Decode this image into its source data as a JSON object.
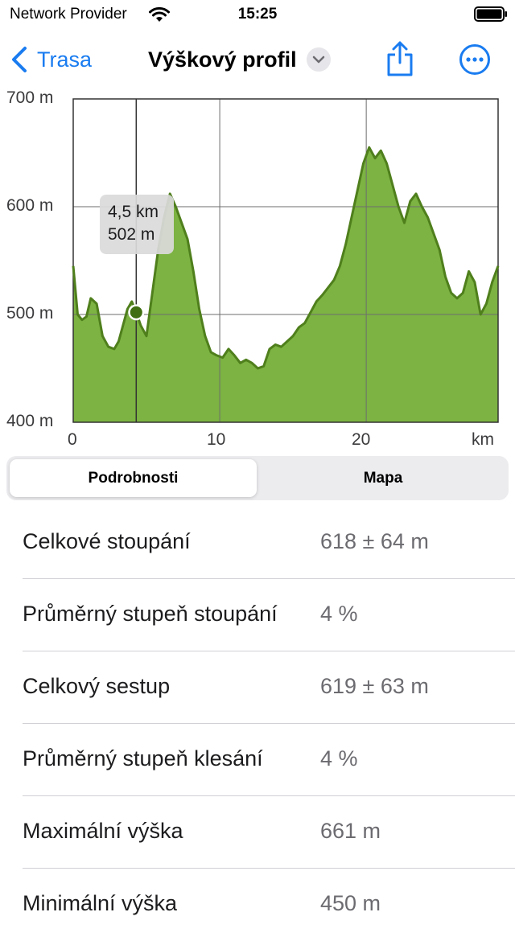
{
  "status": {
    "carrier": "Network Provider",
    "time": "15:25",
    "wifi_icon": "wifi-icon",
    "battery_icon": "battery-icon"
  },
  "nav": {
    "back_label": "Trasa",
    "title": "Výškový profil",
    "title_icon": "chevron-down-icon",
    "share_icon": "share-icon",
    "more_icon": "more-icon"
  },
  "colors": {
    "accent": "#1a7cf0",
    "fill": "#7cb342",
    "line": "#4f7f1c",
    "marker": "#3f6f12"
  },
  "chart_data": {
    "type": "area",
    "y_ticks": [
      "700 m",
      "600 m",
      "500 m",
      "400 m"
    ],
    "x_ticks": [
      "0",
      "10",
      "20",
      "km"
    ],
    "ylim": [
      400,
      700
    ],
    "xlim": [
      0,
      29
    ],
    "grid": true,
    "tooltip": {
      "distance": "4,5 km",
      "elevation": "502 m"
    },
    "marker": {
      "x": 4.3,
      "y": 502
    },
    "x": [
      0,
      0.3,
      0.6,
      0.9,
      1.2,
      1.6,
      2,
      2.4,
      2.8,
      3.1,
      3.4,
      3.7,
      4.0,
      4.3,
      4.6,
      5.0,
      5.4,
      5.8,
      6.2,
      6.6,
      7.0,
      7.4,
      7.8,
      8.2,
      8.6,
      9.0,
      9.4,
      9.8,
      10.2,
      10.6,
      11.0,
      11.4,
      11.8,
      12.2,
      12.6,
      13.0,
      13.4,
      13.8,
      14.2,
      14.6,
      15.0,
      15.4,
      15.8,
      16.2,
      16.6,
      17.0,
      17.4,
      17.8,
      18.2,
      18.6,
      19.0,
      19.4,
      19.8,
      20.2,
      20.6,
      21.0,
      21.4,
      21.8,
      22.2,
      22.6,
      23.0,
      23.4,
      23.8,
      24.2,
      24.6,
      25.0,
      25.4,
      25.8,
      26.2,
      26.6,
      27.0,
      27.4,
      27.8,
      28.2,
      28.6,
      29.0
    ],
    "y": [
      545,
      500,
      495,
      498,
      515,
      510,
      480,
      470,
      468,
      475,
      490,
      505,
      512,
      502,
      490,
      480,
      520,
      560,
      590,
      612,
      600,
      585,
      570,
      540,
      505,
      480,
      465,
      462,
      460,
      468,
      462,
      455,
      458,
      455,
      450,
      452,
      468,
      472,
      470,
      475,
      480,
      488,
      492,
      502,
      512,
      518,
      525,
      532,
      545,
      565,
      590,
      615,
      640,
      655,
      645,
      652,
      640,
      620,
      600,
      585,
      605,
      612,
      600,
      590,
      575,
      560,
      535,
      520,
      515,
      520,
      540,
      530,
      500,
      510,
      530,
      545
    ]
  },
  "tabs": [
    {
      "label": "Podrobnosti",
      "active": true
    },
    {
      "label": "Mapa",
      "active": false
    }
  ],
  "details": [
    {
      "label": "Celkové stoupání",
      "value": "618 ± 64 m"
    },
    {
      "label": "Průměrný stupeň stoupání",
      "value": "4 %"
    },
    {
      "label": "Celkový sestup",
      "value": "619 ± 63 m"
    },
    {
      "label": "Průměrný stupeň klesání",
      "value": "4 %"
    },
    {
      "label": "Maximální výška",
      "value": "661 m"
    },
    {
      "label": "Minimální výška",
      "value": "450 m"
    }
  ]
}
